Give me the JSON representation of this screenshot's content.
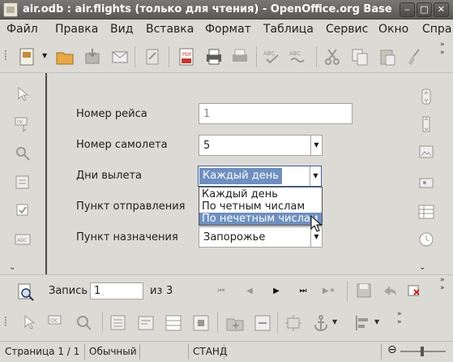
{
  "window": {
    "title": "air.odb : air.flights (только для чтения) - OpenOffice.org Base",
    "minimize_glyph": "‒",
    "maximize_glyph": "□",
    "close_glyph": "✕"
  },
  "menu": [
    "Файл",
    "Правка",
    "Вид",
    "Вставка",
    "Формат",
    "Таблица",
    "Сервис",
    "Окно",
    "Спра"
  ],
  "toolbar_icons": [
    "edit-doc-icon",
    "open-folder-icon",
    "save-icon",
    "email-icon",
    "edit-file-icon",
    "export-pdf-icon",
    "print-icon",
    "print-preview-icon",
    "spellcheck-icon",
    "autospellcheck-icon",
    "cut-icon",
    "copy-icon",
    "paste-icon",
    "format-paintbrush-icon"
  ],
  "form": {
    "fields": [
      {
        "label": "Номер рейса",
        "value": "1"
      },
      {
        "label": "Номер самолета",
        "value": "5"
      },
      {
        "label": "Дни вылета",
        "value": "Каждый день"
      },
      {
        "label": "Пункт отправления",
        "value": ""
      },
      {
        "label": "Пункт назначения",
        "value": "Запорожье"
      }
    ],
    "dropdown_options": [
      "Каждый день",
      "По четным числам",
      "По нечетным числам"
    ],
    "dropdown_selected": "По нечетным числам"
  },
  "nav": {
    "record_label": "Запись",
    "record_value": "1",
    "of_label": "из",
    "total": "3"
  },
  "status": {
    "page": "Страница  1 / 1",
    "style": "Обычный",
    "mode": "СТАНД"
  },
  "colors": {
    "selection": "#6e8fbf",
    "titlebar": "#5b5956",
    "background": "#dcdad5"
  }
}
